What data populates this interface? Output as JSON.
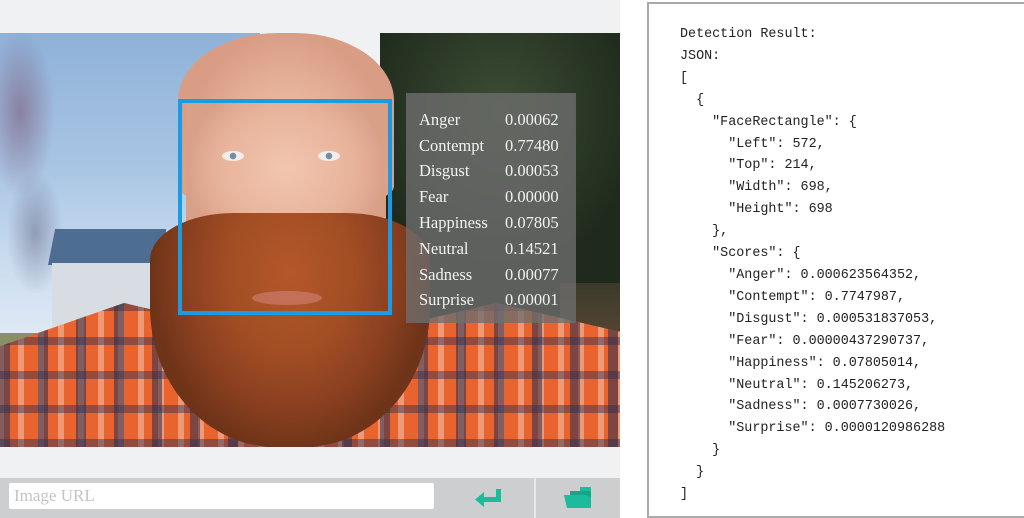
{
  "colors": {
    "accent": "#1abc9c",
    "face_rect": "#1b9be3",
    "panel_bg": "#f0f1f3",
    "bar_bg": "#cdcecf"
  },
  "photo": {
    "description": "Bearded man with red beard in orange plaid shirt outdoors",
    "face_rectangle_visible": true
  },
  "score_overlay": {
    "rows": [
      {
        "label": "Anger",
        "value": "0.00062"
      },
      {
        "label": "Contempt",
        "value": "0.77480"
      },
      {
        "label": "Disgust",
        "value": "0.00053"
      },
      {
        "label": "Fear",
        "value": "0.00000"
      },
      {
        "label": "Happiness",
        "value": "0.07805"
      },
      {
        "label": "Neutral",
        "value": "0.14521"
      },
      {
        "label": "Sadness",
        "value": "0.00077"
      },
      {
        "label": "Surprise",
        "value": "0.00001"
      }
    ]
  },
  "url_bar": {
    "placeholder": "Image URL",
    "value": "",
    "submit_icon": "enter-arrow-icon",
    "open_icon": "folder-open-icon"
  },
  "result": {
    "lines": [
      "Detection Result:",
      "JSON:",
      "[",
      "  {",
      "    \"FaceRectangle\": {",
      "      \"Left\": 572,",
      "      \"Top\": 214,",
      "      \"Width\": 698,",
      "      \"Height\": 698",
      "    },",
      "    \"Scores\": {",
      "      \"Anger\": 0.000623564352,",
      "      \"Contempt\": 0.7747987,",
      "      \"Disgust\": 0.000531837053,",
      "      \"Fear\": 0.00000437290737,",
      "      \"Happiness\": 0.07805014,",
      "      \"Neutral\": 0.145206273,",
      "      \"Sadness\": 0.0007730026,",
      "      \"Surprise\": 0.0000120986288",
      "    }",
      "  }",
      "]"
    ]
  }
}
